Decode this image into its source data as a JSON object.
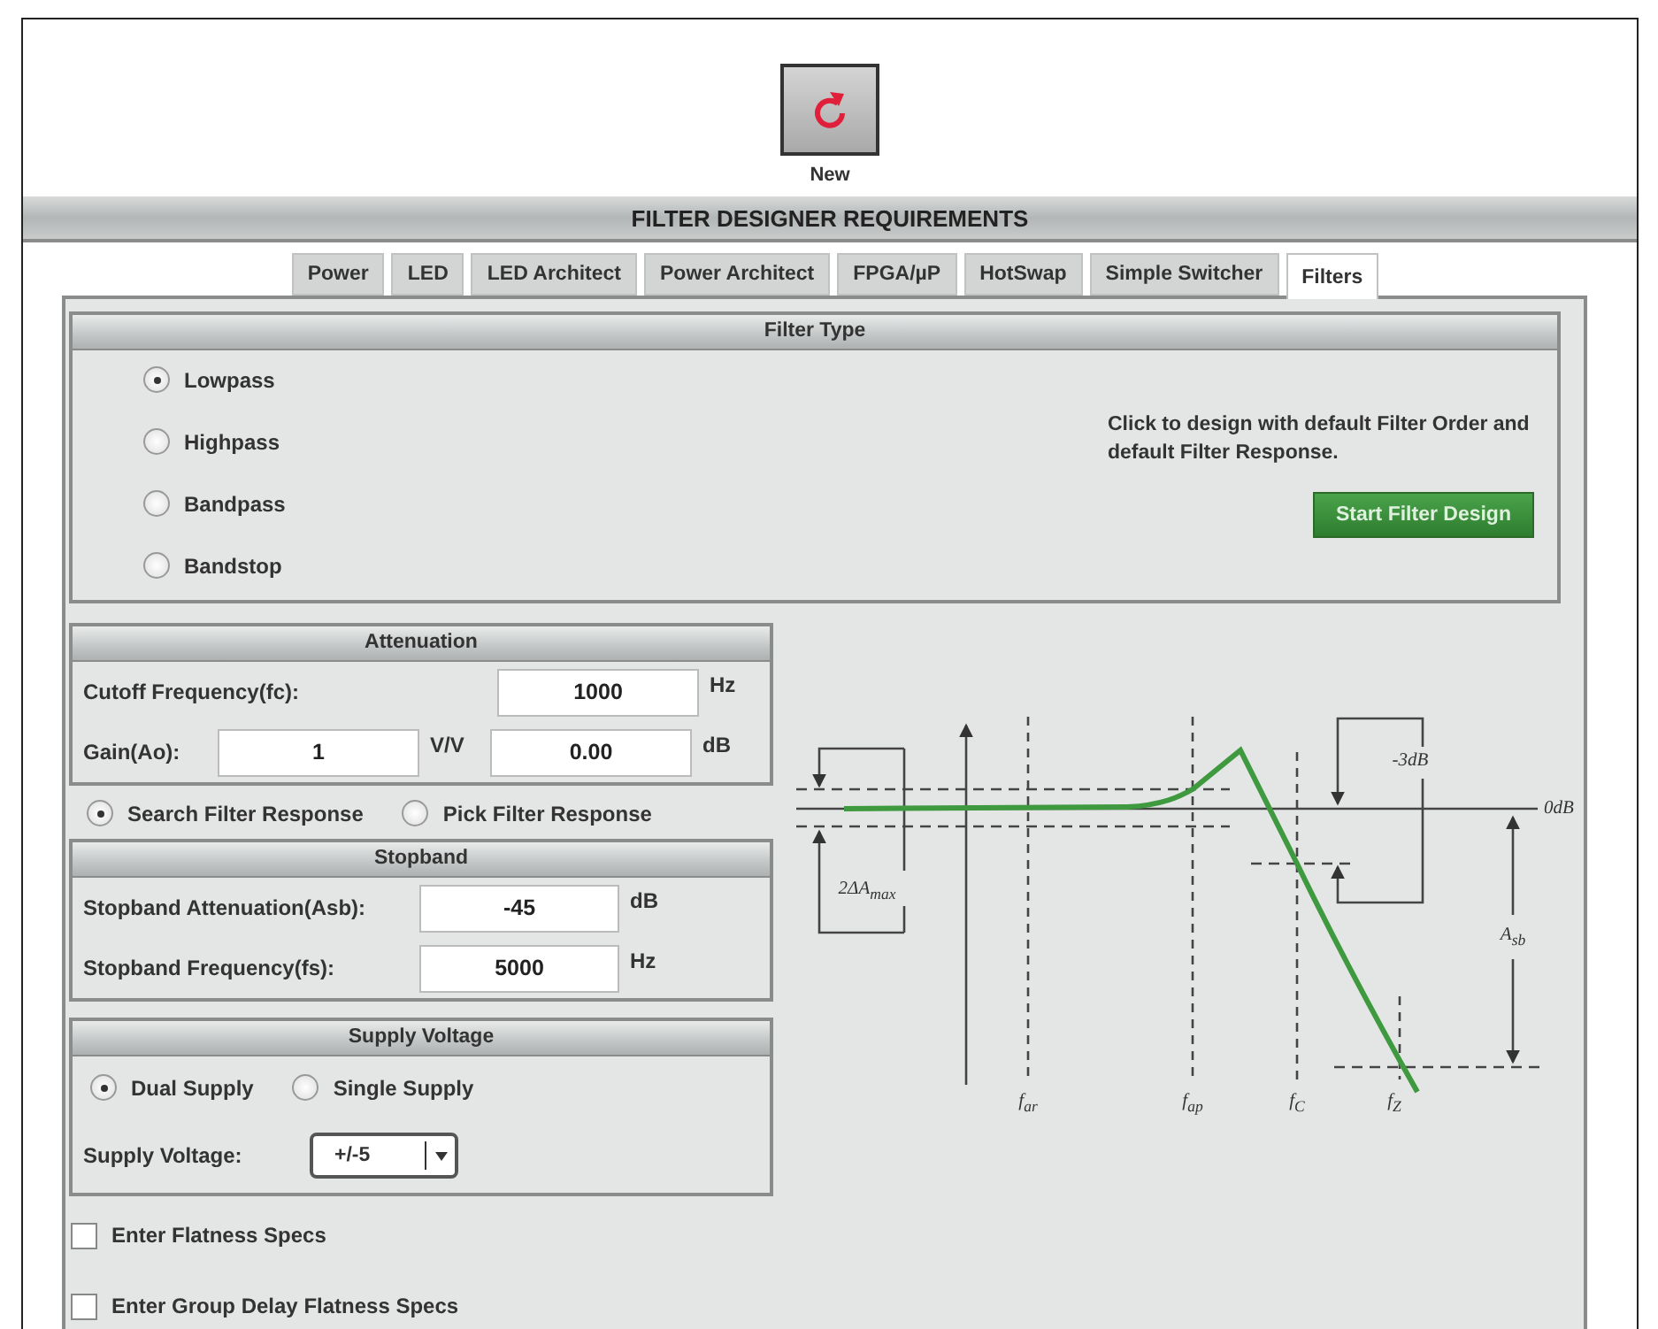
{
  "new_button": {
    "label": "New"
  },
  "header": {
    "title": "FILTER DESIGNER REQUIREMENTS"
  },
  "tabs": [
    {
      "label": "Power",
      "selected": false
    },
    {
      "label": "LED",
      "selected": false
    },
    {
      "label": "LED Architect",
      "selected": false
    },
    {
      "label": "Power Architect",
      "selected": false
    },
    {
      "label": "FPGA/µP",
      "selected": false
    },
    {
      "label": "HotSwap",
      "selected": false
    },
    {
      "label": "Simple Switcher",
      "selected": false
    },
    {
      "label": "Filters",
      "selected": true
    }
  ],
  "filter_type": {
    "title": "Filter Type",
    "options": [
      {
        "label": "Lowpass",
        "selected": true
      },
      {
        "label": "Highpass",
        "selected": false
      },
      {
        "label": "Bandpass",
        "selected": false
      },
      {
        "label": "Bandstop",
        "selected": false
      }
    ],
    "hint": "Click to design with default Filter Order and default Filter Response.",
    "button": "Start Filter Design"
  },
  "attenuation": {
    "title": "Attenuation",
    "cutoff": {
      "label": "Cutoff Frequency(fc):",
      "value": "1000",
      "unit": "Hz"
    },
    "gain": {
      "label": "Gain(Ao):",
      "value": "1",
      "unit": "V/V",
      "db_value": "0.00",
      "db_unit": "dB"
    }
  },
  "response_mode": [
    {
      "label": "Search Filter Response",
      "selected": true
    },
    {
      "label": "Pick Filter Response",
      "selected": false
    }
  ],
  "stopband": {
    "title": "Stopband",
    "fields": [
      {
        "label": "Stopband Attenuation(Asb):",
        "value": "-45",
        "unit": "dB"
      },
      {
        "label": "Stopband Frequency(fs):",
        "value": "5000",
        "unit": "Hz"
      }
    ]
  },
  "supply_voltage": {
    "title": "Supply Voltage",
    "options": [
      {
        "label": "Dual Supply",
        "selected": true
      },
      {
        "label": "Single Supply",
        "selected": false
      }
    ],
    "select": {
      "label": "Supply Voltage:",
      "value": "+/-5"
    }
  },
  "checkboxes": [
    {
      "label": "Enter Flatness Specs",
      "checked": false
    },
    {
      "label": "Enter Group Delay Flatness Specs",
      "checked": false
    }
  ],
  "diagram": {
    "labels": [
      "0dB",
      "-3dB",
      "2ΔA$_{max}$",
      "A$_{sb}$",
      "f$_{ar}$",
      "f$_{ap}$",
      "f$_{C}$",
      "f$_{Z}$"
    ]
  }
}
